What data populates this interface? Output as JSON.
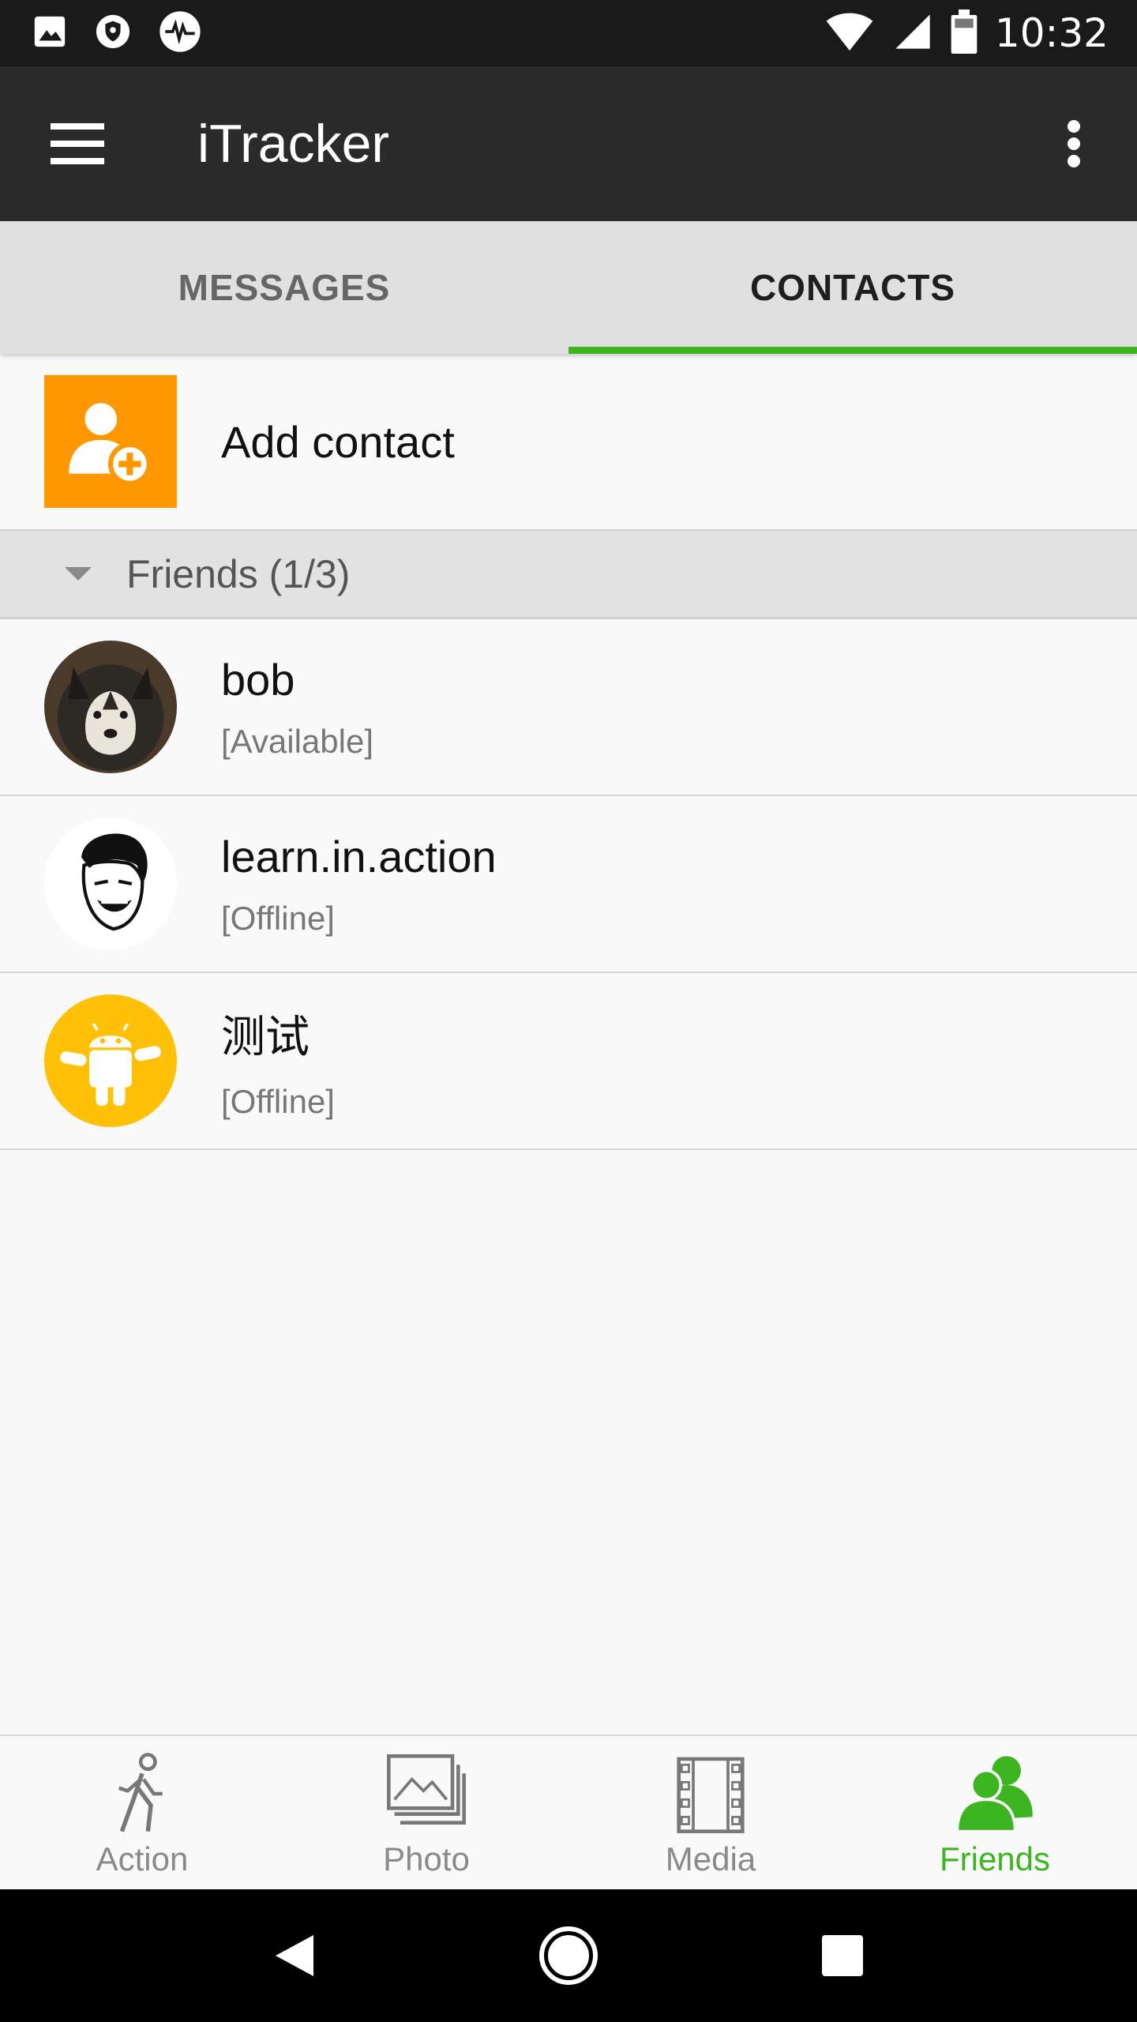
{
  "status_bar": {
    "time": "10:32",
    "left_icons": [
      "image-icon",
      "shield-icon",
      "activity-icon"
    ],
    "right_icons": [
      "wifi-icon",
      "signal-icon",
      "battery-icon"
    ]
  },
  "app_bar": {
    "title": "iTracker",
    "menu_icon": "hamburger-menu-icon",
    "overflow_icon": "more-vert-icon"
  },
  "tabs": [
    {
      "label": "MESSAGES",
      "active": false
    },
    {
      "label": "CONTACTS",
      "active": true
    }
  ],
  "add_contact": {
    "label": "Add contact",
    "icon": "add-person-icon",
    "icon_bg": "#ff9800"
  },
  "group": {
    "label": "Friends (1/3)",
    "expanded": true
  },
  "contacts": [
    {
      "name": "bob",
      "status": "[Available]",
      "avatar": "husky-dog-avatar"
    },
    {
      "name": "learn.in.action",
      "status": "[Offline]",
      "avatar": "meme-face-avatar"
    },
    {
      "name": "测试",
      "status": "[Offline]",
      "avatar": "android-robot-avatar"
    }
  ],
  "bottom_nav": [
    {
      "label": "Action",
      "icon": "walking-person-icon",
      "active": false
    },
    {
      "label": "Photo",
      "icon": "photo-stack-icon",
      "active": false
    },
    {
      "label": "Media",
      "icon": "film-strip-icon",
      "active": false
    },
    {
      "label": "Friends",
      "icon": "people-icon",
      "active": true
    }
  ],
  "system_nav": [
    "back-icon",
    "home-icon",
    "recents-icon"
  ],
  "colors": {
    "accent_green": "#3cb521",
    "app_bar": "#2b2b2b",
    "status_bar": "#1a1a1a",
    "tab_bg": "#e0e0e0"
  }
}
